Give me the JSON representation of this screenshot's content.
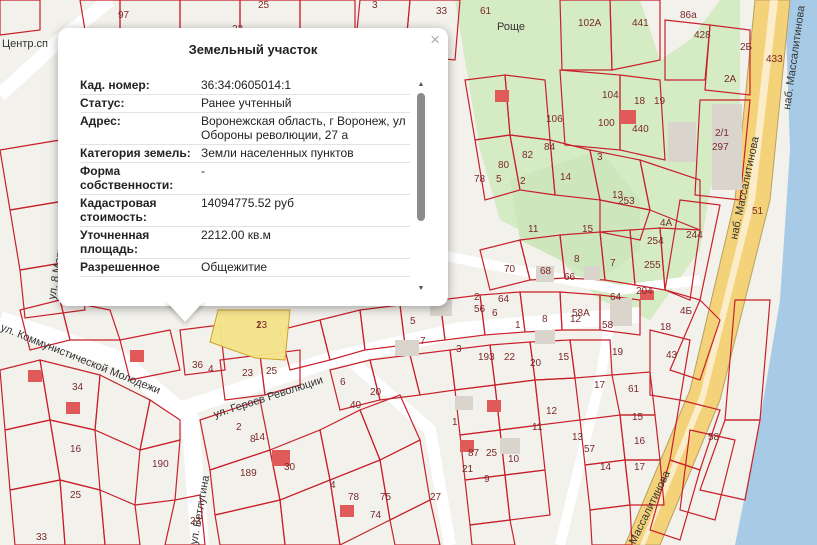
{
  "popup": {
    "title": "Земельный участок",
    "close_label": "×",
    "rows": [
      {
        "key": "Кад. номер:",
        "value": "36:34:0605014:1"
      },
      {
        "key": "Статус:",
        "value": "Ранее учтенный"
      },
      {
        "key": "Адрес:",
        "value": "Воронежская область, г Воронеж, ул Обороны революции, 27 а"
      },
      {
        "key": "Категория земель:",
        "value": "Земли населенных пунктов"
      },
      {
        "key": "Форма собственности:",
        "value": "-"
      },
      {
        "key": "Кадастровая стоимость:",
        "value": "14094775.52 руб"
      },
      {
        "key": "Уточненная площадь:",
        "value": "2212.00 кв.м"
      },
      {
        "key": "Разрешенное",
        "value": "Общежитие"
      }
    ],
    "scroll_up_icon": "arrow-up-icon",
    "scroll_down_icon": "arrow-down-icon"
  },
  "map": {
    "colors": {
      "background": "#f3f1ec",
      "parcel_stroke": "#c8202a",
      "park": "#d4ebc4",
      "highway": "#f4d27a",
      "water": "#a7cbe6",
      "selected_parcel": "#f6e48a"
    },
    "roads": [
      {
        "name": "ул. Героев Революции"
      },
      {
        "name": "ул. Коммунистической Молодежи"
      },
      {
        "name": "наб. Массалитинова"
      },
      {
        "name": "наб. Массалитинова"
      },
      {
        "name": "ул. Ветлугина"
      },
      {
        "name": "ул. 8 Марта"
      },
      {
        "name": "Массалитинова"
      }
    ],
    "place_labels": [
      "Центр.сп",
      "Роще"
    ],
    "parcel_numbers": [
      "97",
      "25",
      "22",
      "3",
      "33",
      "61",
      "102А",
      "441",
      "86а",
      "2Б",
      "2А",
      "428",
      "433",
      "297",
      "2/1",
      "106",
      "104",
      "100",
      "18",
      "19",
      "440",
      "80",
      "82",
      "84",
      "3",
      "5",
      "2",
      "14",
      "253",
      "4А",
      "244",
      "78",
      "254",
      "255",
      "11",
      "13",
      "15",
      "8",
      "7",
      "204",
      "70",
      "68",
      "66",
      "64",
      "4Б",
      "51",
      "2",
      "64",
      "1",
      "8",
      "12",
      "58",
      "58А",
      "56",
      "6",
      "7",
      "5",
      "3",
      "193",
      "22",
      "20",
      "15",
      "17",
      "61",
      "40",
      "36",
      "4",
      "23",
      "25",
      "8",
      "6",
      "2",
      "14",
      "30",
      "4",
      "78",
      "75",
      "74",
      "189",
      "190",
      "23",
      "29/2",
      "25",
      "21",
      "87",
      "57",
      "58",
      "43",
      "16",
      "25",
      "33",
      "34",
      "27",
      "23",
      "1",
      "9",
      "10",
      "11",
      "12",
      "13",
      "14",
      "15",
      "16",
      "17",
      "18",
      "19",
      "20",
      "4",
      "437",
      "40"
    ],
    "selected_parcel_label": "1"
  }
}
